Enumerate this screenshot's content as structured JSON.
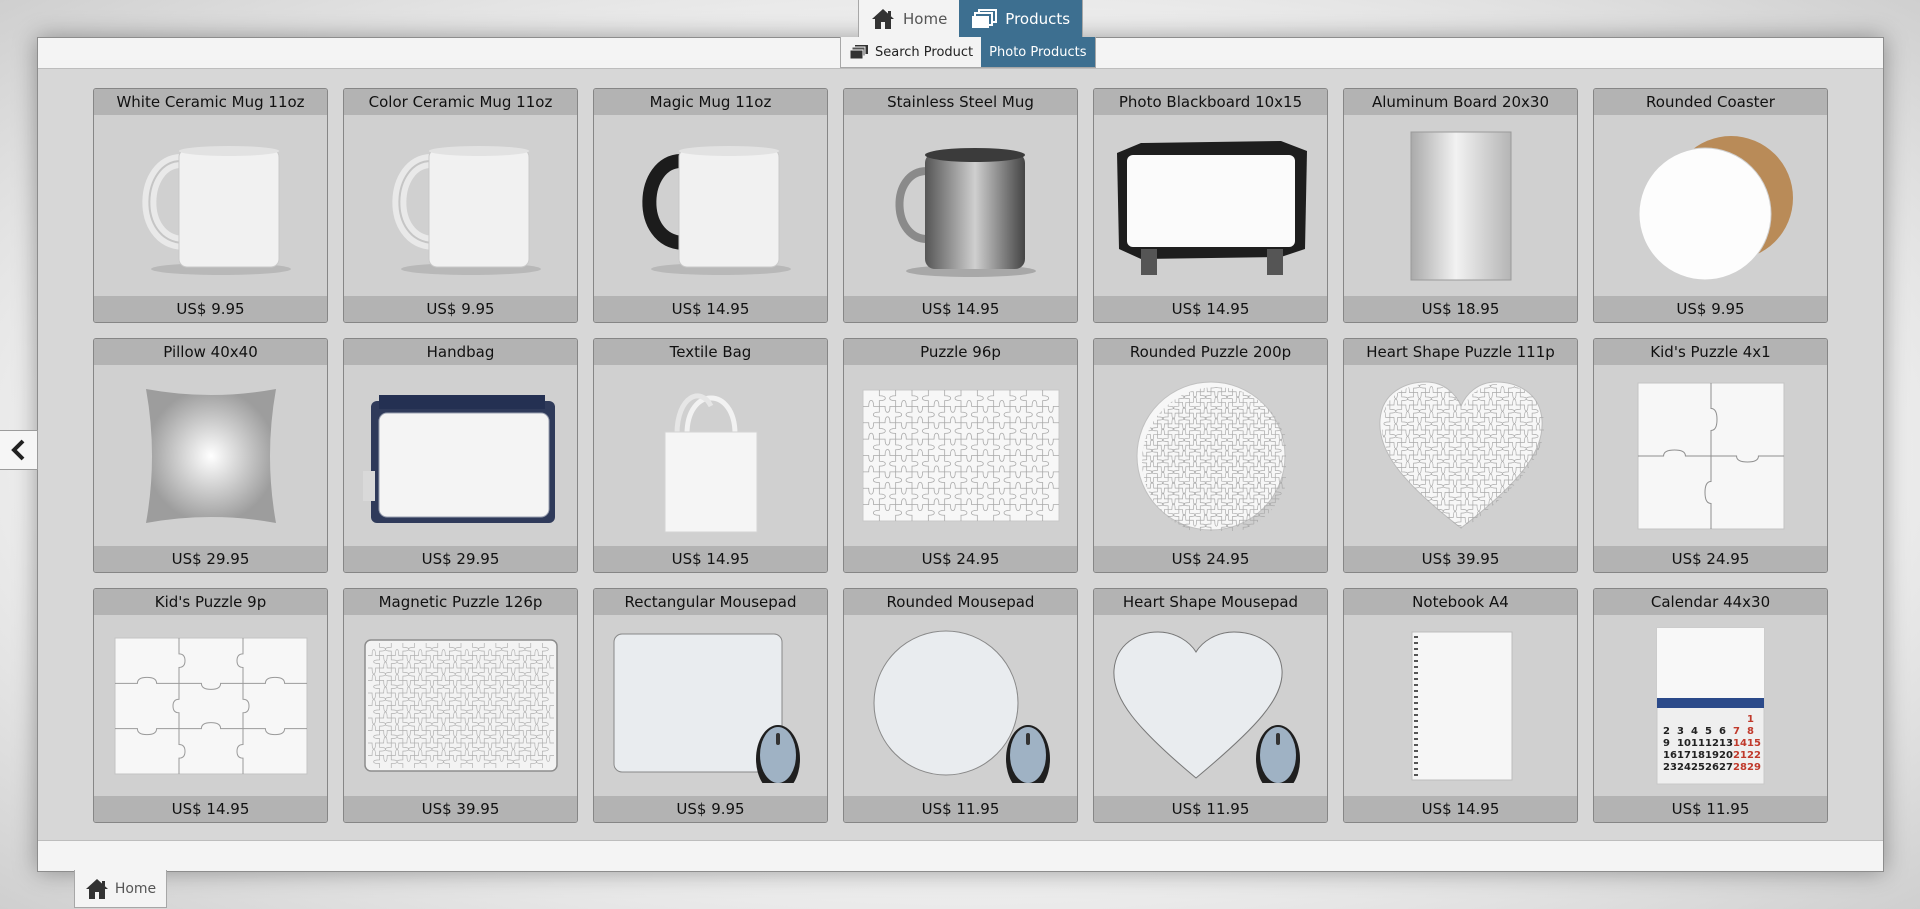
{
  "nav": {
    "top_tabs": [
      {
        "label": "Home",
        "icon": "home-icon"
      },
      {
        "label": "Products",
        "icon": "stack-icon",
        "active": true
      }
    ],
    "sub_tabs": [
      {
        "label": "Search Product",
        "icon": "stack-icon"
      },
      {
        "label": "Photo Products",
        "active": true
      }
    ],
    "bottom_tab": {
      "label": "Home",
      "icon": "home-icon"
    },
    "side_toggle_icon": "chevron-left-icon"
  },
  "colors": {
    "accent": "#3d6f90",
    "card_bg": "#d0d0d0",
    "card_bar": "#b3b3b3"
  },
  "products": [
    {
      "name": "White Ceramic Mug 11oz",
      "price": "US$ 9.95",
      "image": "white-mug"
    },
    {
      "name": "Color Ceramic Mug 11oz",
      "price": "US$ 9.95",
      "image": "white-mug"
    },
    {
      "name": "Magic Mug 11oz",
      "price": "US$ 14.95",
      "image": "magic-mug"
    },
    {
      "name": "Stainless Steel Mug",
      "price": "US$ 14.95",
      "image": "steel-mug"
    },
    {
      "name": "Photo Blackboard 10x15",
      "price": "US$ 14.95",
      "image": "blackboard"
    },
    {
      "name": "Aluminum Board 20x30",
      "price": "US$ 18.95",
      "image": "aluminum-board"
    },
    {
      "name": "Rounded Coaster",
      "price": "US$ 9.95",
      "image": "coaster"
    },
    {
      "name": "Pillow 40x40",
      "price": "US$ 29.95",
      "image": "pillow"
    },
    {
      "name": "Handbag",
      "price": "US$ 29.95",
      "image": "handbag"
    },
    {
      "name": "Textile Bag",
      "price": "US$ 14.95",
      "image": "textile-bag"
    },
    {
      "name": "Puzzle 96p",
      "price": "US$ 24.95",
      "image": "puzzle-rect"
    },
    {
      "name": "Rounded Puzzle 200p",
      "price": "US$ 24.95",
      "image": "puzzle-round"
    },
    {
      "name": "Heart Shape Puzzle 111p",
      "price": "US$ 39.95",
      "image": "puzzle-heart"
    },
    {
      "name": "Kid's Puzzle 4x1",
      "price": "US$ 24.95",
      "image": "kids-puzzle-4"
    },
    {
      "name": "Kid's Puzzle 9p",
      "price": "US$ 14.95",
      "image": "kids-puzzle-9"
    },
    {
      "name": "Magnetic Puzzle 126p",
      "price": "US$ 39.95",
      "image": "magnetic-puzzle"
    },
    {
      "name": "Rectangular Mousepad",
      "price": "US$ 9.95",
      "image": "mousepad-rect"
    },
    {
      "name": "Rounded Mousepad",
      "price": "US$ 11.95",
      "image": "mousepad-round"
    },
    {
      "name": "Heart Shape Mousepad",
      "price": "US$ 11.95",
      "image": "mousepad-heart"
    },
    {
      "name": "Notebook A4",
      "price": "US$ 14.95",
      "image": "notebook"
    },
    {
      "name": "Calendar 44x30",
      "price": "US$ 11.95",
      "image": "calendar"
    }
  ],
  "calendar_dates": [
    [
      "",
      "",
      "",
      "",
      "",
      "",
      "1"
    ],
    [
      "2",
      "3",
      "4",
      "5",
      "6",
      "7",
      "8"
    ],
    [
      "9",
      "10",
      "11",
      "12",
      "13",
      "14",
      "15"
    ],
    [
      "16",
      "17",
      "18",
      "19",
      "20",
      "21",
      "22"
    ],
    [
      "23",
      "24",
      "25",
      "26",
      "27",
      "28",
      "29"
    ]
  ]
}
